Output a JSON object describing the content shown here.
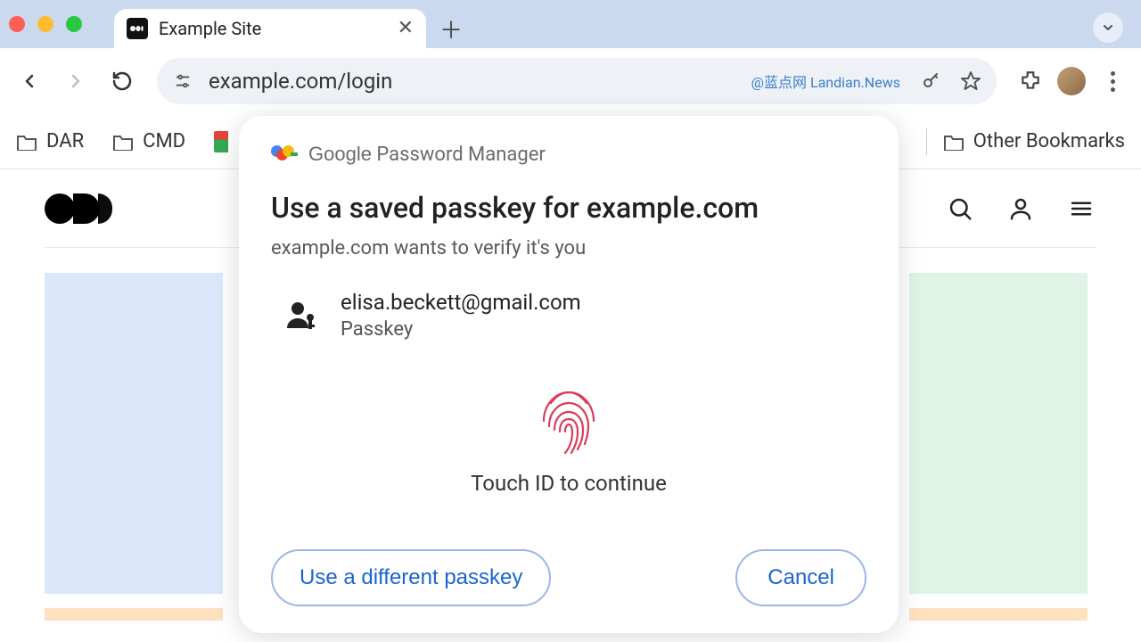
{
  "browser": {
    "tab_title": "Example Site",
    "url": "example.com/login",
    "watermark": "@蓝点网 Landian.News"
  },
  "bookmarks": {
    "items": [
      "DAR",
      "CMD"
    ],
    "other_label": "Other Bookmarks"
  },
  "dialog": {
    "manager_brand": "Google",
    "manager_label": "Password Manager",
    "title": "Use a saved passkey for example.com",
    "subtitle": "example.com wants to verify it's you",
    "account": {
      "email": "elisa.beckett@gmail.com",
      "type": "Passkey"
    },
    "prompt": "Touch ID to continue",
    "buttons": {
      "different": "Use a different passkey",
      "cancel": "Cancel"
    }
  }
}
